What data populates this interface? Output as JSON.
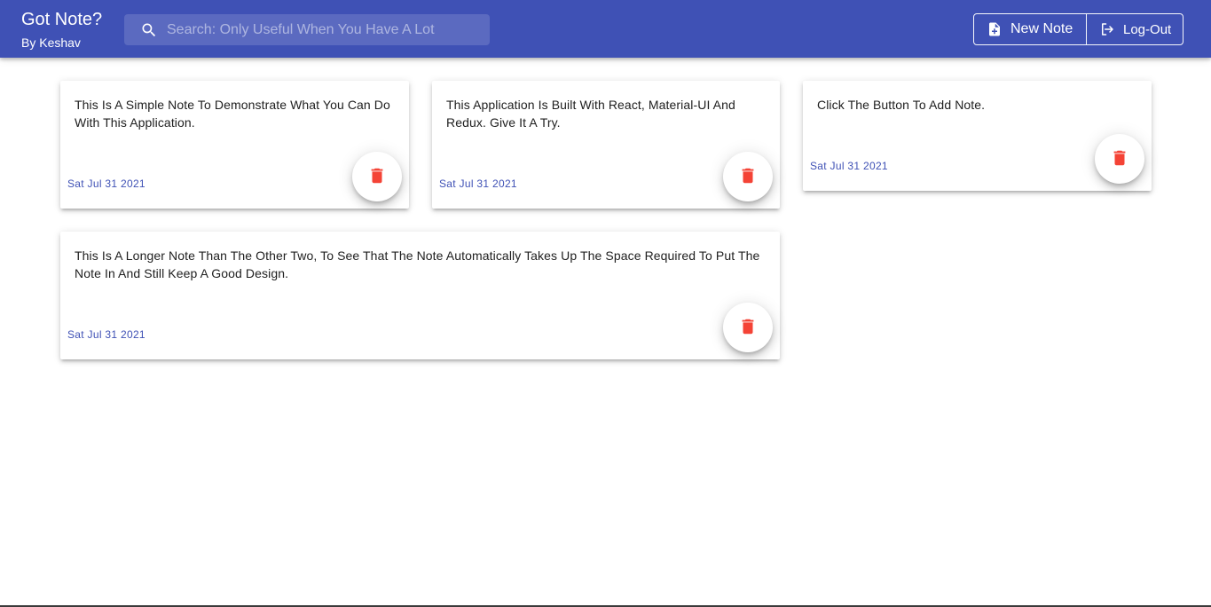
{
  "header": {
    "title": "Got Note?",
    "subtitle": "By Keshav",
    "search_placeholder": "Search: Only Useful When You Have A Lot",
    "new_note_label": "New Note",
    "logout_label": "Log-Out"
  },
  "notes": [
    {
      "text": "This Is A Simple Note To Demonstrate What You Can Do With This Application.",
      "date": "Sat Jul 31 2021"
    },
    {
      "text": "This Application Is Built With React, Material-UI And Redux. Give It A Try.",
      "date": "Sat Jul 31 2021"
    },
    {
      "text": "Click The Button To Add Note.",
      "date": "Sat Jul 31 2021"
    },
    {
      "text": "This Is A Longer Note Than The Other Two, To See That The Note Automatically Takes Up The Space Required To Put The Note In And Still Keep A Good Design.",
      "date": "Sat Jul 31 2021"
    }
  ],
  "colors": {
    "primary": "#3f51b5",
    "delete": "#f44336",
    "date_text": "#3f51b5"
  },
  "icons": {
    "search": "search-icon",
    "new_note": "note-add-icon",
    "logout": "logout-icon",
    "delete": "trash-icon"
  }
}
